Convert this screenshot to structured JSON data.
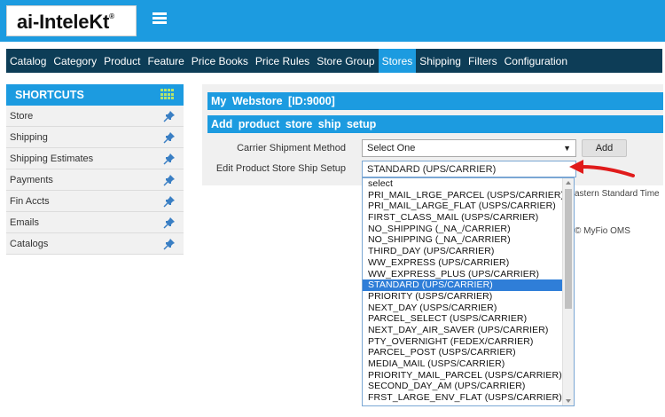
{
  "brand": {
    "logo_text": "ai-InteleKt",
    "logo_reg": "®"
  },
  "nav": {
    "items": [
      {
        "label": "Catalog",
        "active": false
      },
      {
        "label": "Category",
        "active": false
      },
      {
        "label": "Product",
        "active": false
      },
      {
        "label": "Feature",
        "active": false
      },
      {
        "label": "Price Books",
        "active": false
      },
      {
        "label": "Price Rules",
        "active": false
      },
      {
        "label": "Store Group",
        "active": false
      },
      {
        "label": "Stores",
        "active": true
      },
      {
        "label": "Shipping",
        "active": false
      },
      {
        "label": "Filters",
        "active": false
      },
      {
        "label": "Configuration",
        "active": false
      }
    ]
  },
  "sidebar": {
    "title": "SHORTCUTS",
    "items": [
      {
        "label": "Store",
        "icon": "pin-icon"
      },
      {
        "label": "Shipping",
        "icon": "pin-icon"
      },
      {
        "label": "Shipping Estimates",
        "icon": "pin-icon"
      },
      {
        "label": "Payments",
        "icon": "pin-icon"
      },
      {
        "label": "Fin Accts",
        "icon": "pin-icon"
      },
      {
        "label": "Emails",
        "icon": "pin-icon"
      },
      {
        "label": "Catalogs",
        "icon": "pin-icon"
      }
    ]
  },
  "main": {
    "store_title": "My  Webstore  [ID:9000]",
    "section_title": "Add  product  store  ship  setup",
    "carrier_label": "Carrier Shipment Method",
    "carrier_value": "Select One",
    "add_label": "Add",
    "setup_label": "Edit Product Store Ship Setup",
    "setup_value": "STANDARD (UPS/CARRIER)",
    "bg_timezone": "astern Standard Time",
    "bg_footer": "© MyFio OMS"
  },
  "dropdown": {
    "options": [
      "select",
      "PRI_MAIL_LRGE_PARCEL (USPS/CARRIER)",
      "PRI_MAIL_LARGE_FLAT (USPS/CARRIER)",
      "FIRST_CLASS_MAIL (USPS/CARRIER)",
      "NO_SHIPPING (_NA_/CARRIER)",
      "NO_SHIPPING (_NA_/CARRIER)",
      "THIRD_DAY (UPS/CARRIER)",
      "WW_EXPRESS (UPS/CARRIER)",
      "WW_EXPRESS_PLUS (UPS/CARRIER)",
      "STANDARD (UPS/CARRIER)",
      "PRIORITY (USPS/CARRIER)",
      "NEXT_DAY (USPS/CARRIER)",
      "PARCEL_SELECT (USPS/CARRIER)",
      "NEXT_DAY_AIR_SAVER (UPS/CARRIER)",
      "PTY_OVERNIGHT (FEDEX/CARRIER)",
      "PARCEL_POST (USPS/CARRIER)",
      "MEDIA_MAIL (USPS/CARRIER)",
      "PRIORITY_MAIL_PARCEL (USPS/CARRIER)",
      "SECOND_DAY_AM (UPS/CARRIER)",
      "FRST_LARGE_ENV_FLAT (USPS/CARRIER)"
    ],
    "selected_index": 9
  },
  "colors": {
    "accent": "#1c9be0",
    "nav_bg": "#0d3d57",
    "annotation_arrow": "#e01b1b"
  }
}
